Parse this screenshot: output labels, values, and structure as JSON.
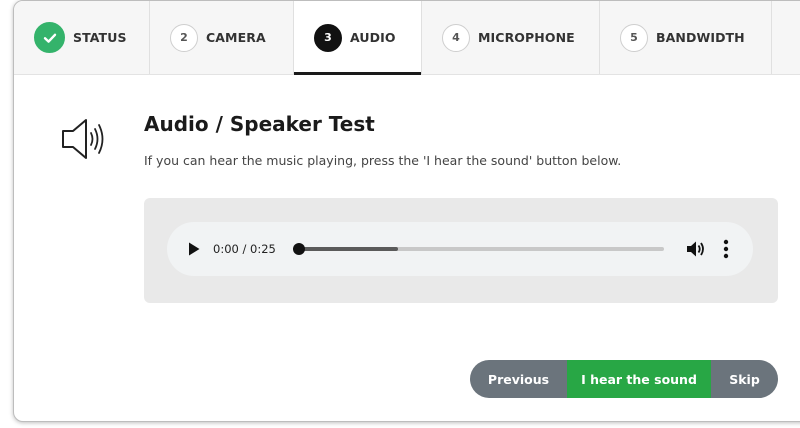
{
  "tabs": [
    {
      "number": "",
      "label": "STATUS",
      "state": "done",
      "icon": "checkmark-icon"
    },
    {
      "number": "2",
      "label": "CAMERA",
      "state": "pending"
    },
    {
      "number": "3",
      "label": "AUDIO",
      "state": "active"
    },
    {
      "number": "4",
      "label": "MICROPHONE",
      "state": "pending"
    },
    {
      "number": "5",
      "label": "BANDWIDTH",
      "state": "pending"
    }
  ],
  "content": {
    "icon": "speaker-icon",
    "title": "Audio / Speaker Test",
    "subtitle": "If you can hear the music playing, press the 'I hear the sound' button below."
  },
  "player": {
    "time": "0:00 / 0:25",
    "progress_played_fraction": 0,
    "progress_buffered_fraction": 0.27,
    "icons": [
      "play-icon",
      "volume-icon",
      "more-vertical-icon"
    ]
  },
  "buttons": {
    "previous": "Previous",
    "hear": "I hear the sound",
    "skip": "Skip"
  },
  "colors": {
    "done": "#34b36b",
    "active": "#111111",
    "primary_button": "#28a745",
    "secondary_button": "#6b747c"
  }
}
